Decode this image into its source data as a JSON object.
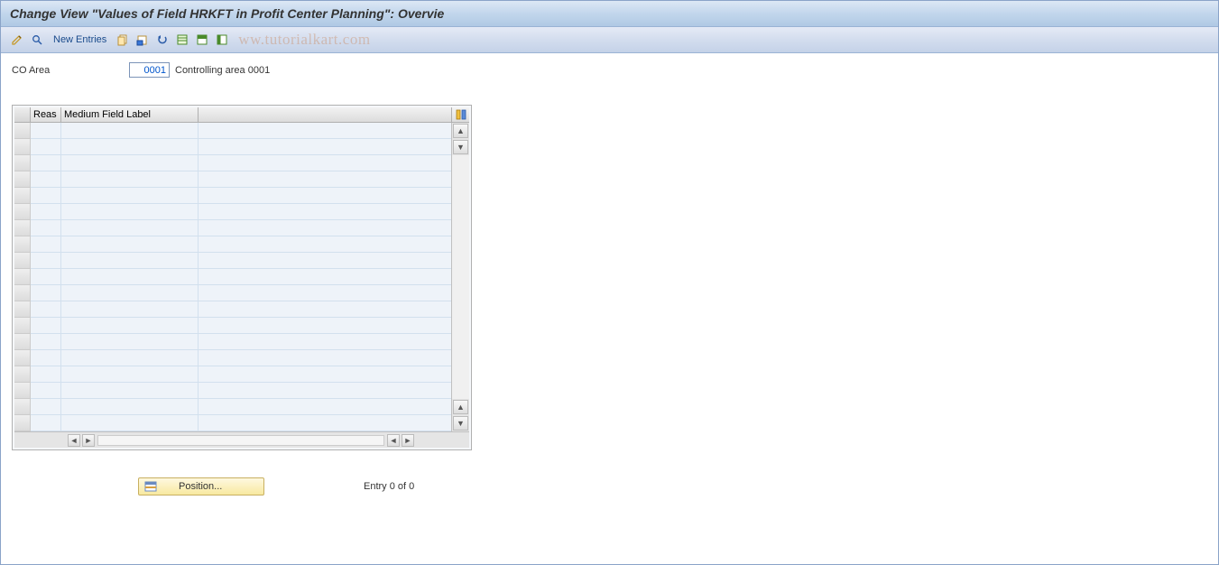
{
  "title": "Change View \"Values of Field HRKFT in Profit Center Planning\": Overvie",
  "toolbar": {
    "new_entries": "New Entries"
  },
  "co_area": {
    "label": "CO Area",
    "value": "0001",
    "desc": "Controlling area 0001"
  },
  "table": {
    "col_reas": "Reas",
    "col_medium": "Medium Field Label",
    "rows": [
      {
        "reas": "",
        "medium": ""
      },
      {
        "reas": "",
        "medium": ""
      },
      {
        "reas": "",
        "medium": ""
      },
      {
        "reas": "",
        "medium": ""
      },
      {
        "reas": "",
        "medium": ""
      },
      {
        "reas": "",
        "medium": ""
      },
      {
        "reas": "",
        "medium": ""
      },
      {
        "reas": "",
        "medium": ""
      },
      {
        "reas": "",
        "medium": ""
      },
      {
        "reas": "",
        "medium": ""
      },
      {
        "reas": "",
        "medium": ""
      },
      {
        "reas": "",
        "medium": ""
      },
      {
        "reas": "",
        "medium": ""
      },
      {
        "reas": "",
        "medium": ""
      },
      {
        "reas": "",
        "medium": ""
      },
      {
        "reas": "",
        "medium": ""
      },
      {
        "reas": "",
        "medium": ""
      },
      {
        "reas": "",
        "medium": ""
      },
      {
        "reas": "",
        "medium": ""
      }
    ]
  },
  "position_btn": "Position...",
  "entry_status": "Entry 0 of 0",
  "watermark": "ww.tutorialkart.com"
}
